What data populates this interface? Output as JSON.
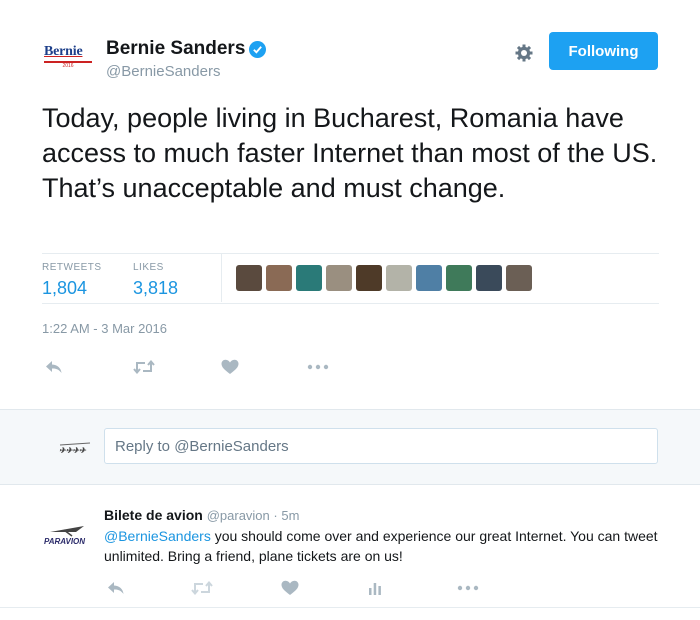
{
  "profile": {
    "logo_text": "Bernie",
    "logo_year": "2016",
    "name": "Bernie Sanders",
    "handle": "@BernieSanders"
  },
  "follow_button": {
    "label": "Following"
  },
  "tweet": {
    "text": "Today, people living in Bucharest, Romania have access to much faster Internet than most of the US. That’s unacceptable and must change.",
    "timestamp": "1:22 AM - 3 Mar 2016"
  },
  "stats": {
    "retweets_label": "RETWEETS",
    "retweets_value": "1,804",
    "likes_label": "LIKES",
    "likes_value": "3,818"
  },
  "liker_avatars": [
    {
      "color": "#5a4a3e"
    },
    {
      "color": "#8a6a55"
    },
    {
      "color": "#2a7a78"
    },
    {
      "color": "#9a8f80"
    },
    {
      "color": "#4e3a28"
    },
    {
      "color": "#b3b3a8"
    },
    {
      "color": "#4f7fa5"
    },
    {
      "color": "#3f7a5a"
    },
    {
      "color": "#3a4a5a"
    },
    {
      "color": "#6b5f55"
    }
  ],
  "reply_box": {
    "placeholder": "Reply to @BernieSanders"
  },
  "reply": {
    "author": "Bilete de avion",
    "handle": "@paravion",
    "separator": " · ",
    "time": "5m",
    "mention": "@BernieSanders",
    "text": " you should come over and experience our great Internet. You can tweet unlimited. Bring a friend, plane tickets are on us!",
    "logo_text": "PARAVION"
  },
  "colors": {
    "accent": "#1da1f2",
    "link": "#1b95e0",
    "muted": "#8899a6",
    "icon": "#aab8c2"
  }
}
